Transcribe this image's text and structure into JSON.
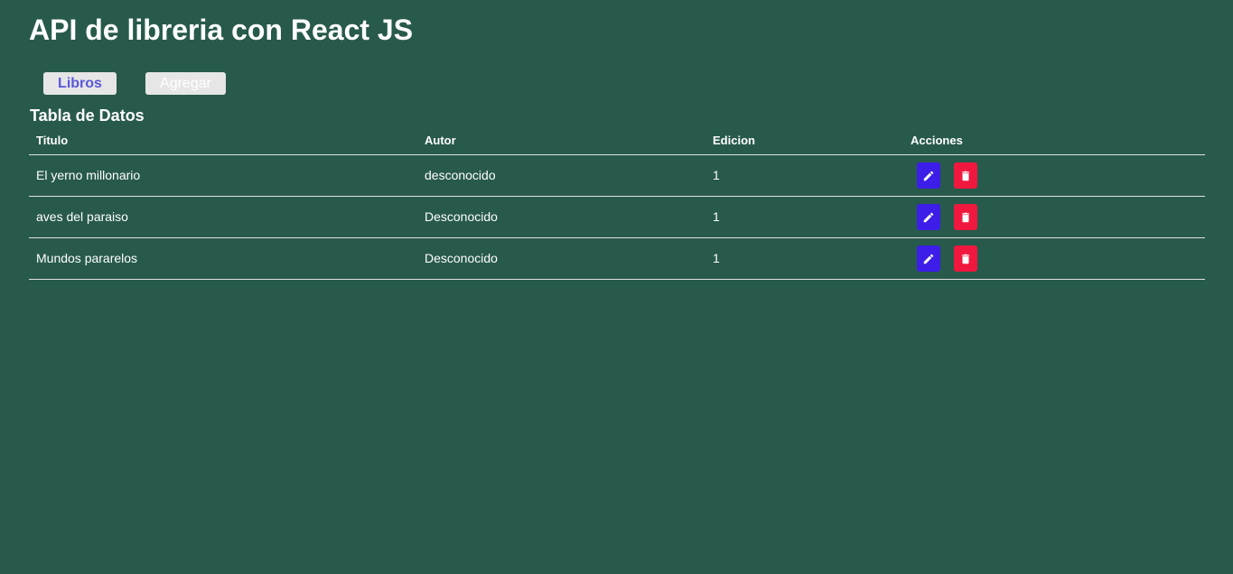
{
  "header": {
    "title": "API de libreria con React JS"
  },
  "nav": {
    "libros_label": "Libros",
    "agregar_label": "Agregar"
  },
  "table": {
    "title": "Tabla de Datos",
    "columns": [
      "Titulo",
      "Autor",
      "Edicion",
      "Acciones"
    ],
    "rows": [
      {
        "titulo": "El yerno millonario",
        "autor": "desconocido",
        "edicion": "1"
      },
      {
        "titulo": "aves del paraiso",
        "autor": "Desconocido",
        "edicion": "1"
      },
      {
        "titulo": "Mundos pararelos",
        "autor": "Desconocido",
        "edicion": "1"
      }
    ],
    "actions": {
      "edit_icon": "pencil-icon",
      "delete_icon": "trash-icon"
    }
  },
  "colors": {
    "background": "#285a4c",
    "edit_button": "#3d1de8",
    "delete_button": "#f0183e",
    "active_nav_text": "#5a57d9"
  }
}
